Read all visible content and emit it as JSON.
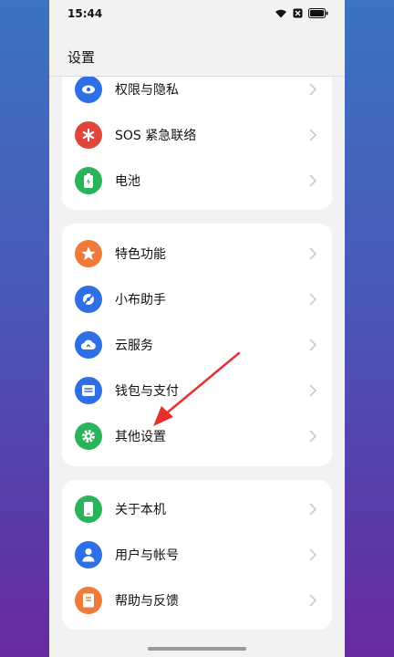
{
  "status_bar": {
    "time": "15:44"
  },
  "header": {
    "title": "设置"
  },
  "group1": [
    {
      "label": "权限与隐私",
      "icon": "privacy-eye-icon",
      "color": "#2f6fe6"
    },
    {
      "label": "SOS 紧急联络",
      "icon": "sos-asterisk-icon",
      "color": "#e0453a"
    },
    {
      "label": "电池",
      "icon": "battery-icon",
      "color": "#2ab35a"
    }
  ],
  "group2": [
    {
      "label": "特色功能",
      "icon": "star-icon",
      "color": "#f07a3a"
    },
    {
      "label": "小布助手",
      "icon": "assistant-icon",
      "color": "#2f6fe6"
    },
    {
      "label": "云服务",
      "icon": "cloud-icon",
      "color": "#2f6fe6"
    },
    {
      "label": "钱包与支付",
      "icon": "wallet-icon",
      "color": "#2f6fe6"
    },
    {
      "label": "其他设置",
      "icon": "gear-icon",
      "color": "#2ab35a"
    }
  ],
  "group3": [
    {
      "label": "关于本机",
      "icon": "phone-icon",
      "color": "#2ab35a"
    },
    {
      "label": "用户与帐号",
      "icon": "user-icon",
      "color": "#2f6fe6"
    },
    {
      "label": "帮助与反馈",
      "icon": "help-book-icon",
      "color": "#f07a3a"
    }
  ],
  "annotation": {
    "color": "#e53030"
  }
}
